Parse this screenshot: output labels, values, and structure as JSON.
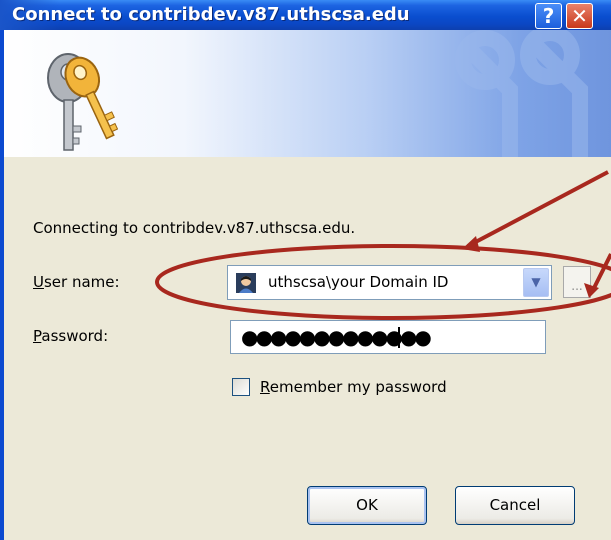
{
  "dialog": {
    "title": "Connect to contribdev.v87.uthscsa.edu",
    "help_glyph": "?",
    "close_glyph": "✕",
    "connecting_text": "Connecting to contribdev.v87.uthscsa.edu.",
    "username": {
      "label_accel": "U",
      "label_rest": "ser name:",
      "value": "uthscsa\\your Domain ID",
      "browse_label": "..."
    },
    "password": {
      "label_accel": "P",
      "label_rest": "assword:",
      "masked_value": "●●●●●●●●●●●●●"
    },
    "remember": {
      "label_accel": "R",
      "label_rest": "emember my password",
      "checked": false
    },
    "ok_label": "OK",
    "cancel_label": "Cancel"
  },
  "colors": {
    "titlebar": "#0b4ad0",
    "dialog_face": "#ece9d8",
    "annotation": "#a8281e"
  },
  "icons": [
    "keys-icon",
    "help-icon",
    "close-icon",
    "user-icon",
    "chevron-down-icon"
  ]
}
